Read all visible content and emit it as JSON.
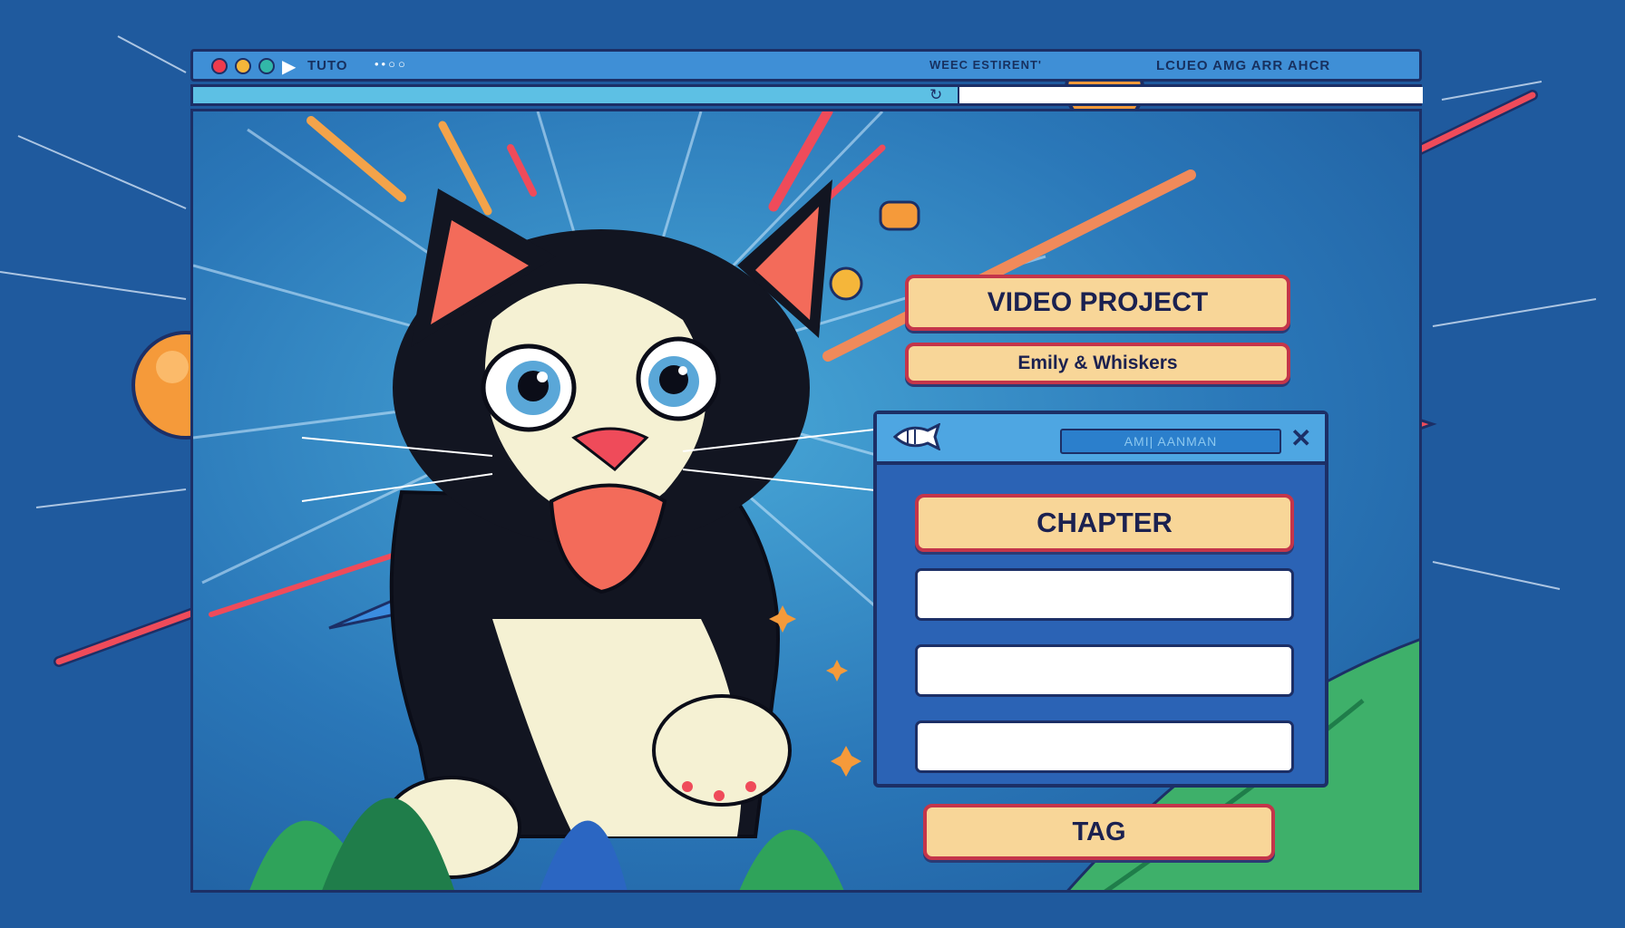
{
  "window": {
    "title_left": "TUTO",
    "title_middle": "WEEC ESTIRENT'",
    "title_right": "LCUEO AMG ARR AHCR",
    "controls": [
      "close-dot",
      "minimize-dot",
      "maximize-dot",
      "play-icon"
    ]
  },
  "project_card": {
    "title": "VIDEO PROJECT",
    "subtitle": "Emily & Whiskers"
  },
  "panel": {
    "search_text": "AMI| AANMAN",
    "close_symbol": "✕",
    "chapter_label": "CHAPTER",
    "fields": [
      "",
      "",
      ""
    ],
    "tag_label": "TAG"
  },
  "colors": {
    "background": "#1f5a9e",
    "outline": "#1c2f66",
    "pill": "#f8d698",
    "pill_border": "#c4354a",
    "accent_orange": "#f59a3a"
  }
}
